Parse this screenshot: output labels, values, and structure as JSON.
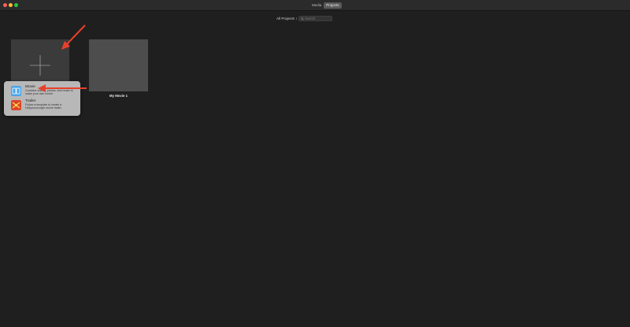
{
  "titlebar": {
    "tabs": [
      {
        "label": "Media",
        "active": false
      },
      {
        "label": "Projects",
        "active": true
      }
    ]
  },
  "toolbar": {
    "filter_label": "All Projects ↕",
    "search_placeholder": "Search"
  },
  "projects": {
    "new_tile_icon": "plus-icon",
    "items": [
      {
        "title": "My Movie 1"
      }
    ]
  },
  "popover": {
    "items": [
      {
        "title": "Movie",
        "description": "Combine videos, photos, and music to make your own movie.",
        "icon": "movie-icon",
        "icon_color": "#4aa3e8"
      },
      {
        "title": "Trailer",
        "description": "Follow a template to create a Hollywood-style movie trailer.",
        "icon": "trailer-icon",
        "icon_color": "#d9452b"
      }
    ]
  },
  "colors": {
    "background": "#1f1f1f",
    "annotation_arrow": "#e8402a"
  }
}
